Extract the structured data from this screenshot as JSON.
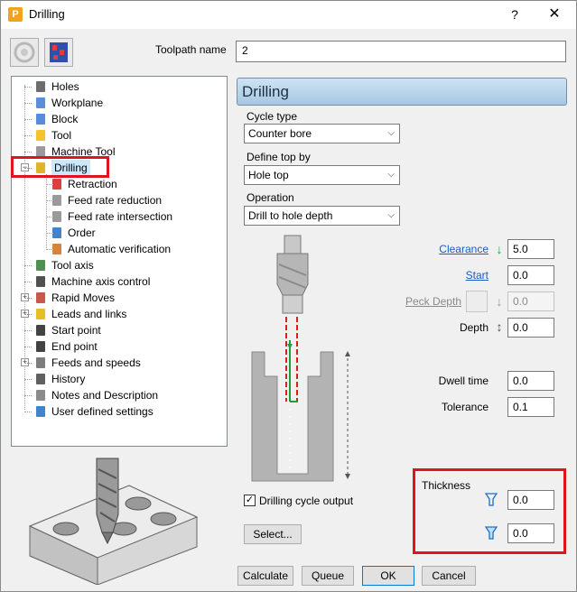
{
  "window": {
    "title": "Drilling",
    "help": "?",
    "close": "✕",
    "app_letter": "P"
  },
  "toolpath": {
    "label": "Toolpath name",
    "value": "2"
  },
  "tree": [
    {
      "label": "Holes",
      "icon": "holes-icon"
    },
    {
      "label": "Workplane",
      "icon": "workplane-icon"
    },
    {
      "label": "Block",
      "icon": "block-icon"
    },
    {
      "label": "Tool",
      "icon": "tool-icon"
    },
    {
      "label": "Machine Tool",
      "icon": "machine-tool-icon"
    },
    {
      "label": "Drilling",
      "icon": "drilling-icon",
      "selected": true,
      "expanded": true
    },
    {
      "label": "Retraction",
      "icon": "retraction-icon"
    },
    {
      "label": "Feed rate reduction",
      "icon": "feed-rate-reduction-icon"
    },
    {
      "label": "Feed rate intersection",
      "icon": "feed-rate-intersection-icon"
    },
    {
      "label": "Order",
      "icon": "order-icon"
    },
    {
      "label": "Automatic verification",
      "icon": "automatic-verification-icon"
    },
    {
      "label": "Tool axis",
      "icon": "tool-axis-icon"
    },
    {
      "label": "Machine axis control",
      "icon": "machine-axis-control-icon"
    },
    {
      "label": "Rapid Moves",
      "icon": "rapid-moves-icon"
    },
    {
      "label": "Leads and links",
      "icon": "leads-and-links-icon"
    },
    {
      "label": "Start point",
      "icon": "start-point-icon"
    },
    {
      "label": "End point",
      "icon": "end-point-icon"
    },
    {
      "label": "Feeds and speeds",
      "icon": "feeds-and-speeds-icon"
    },
    {
      "label": "History",
      "icon": "history-icon"
    },
    {
      "label": "Notes and Description",
      "icon": "notes-icon"
    },
    {
      "label": "User defined settings",
      "icon": "user-settings-icon"
    }
  ],
  "panel": {
    "title": "Drilling",
    "cycle_type": {
      "label": "Cycle type",
      "value": "Counter bore"
    },
    "define_top": {
      "label": "Define top by",
      "value": "Hole top"
    },
    "operation": {
      "label": "Operation",
      "value": "Drill to hole depth"
    },
    "clearance": {
      "label": "Clearance",
      "value": "5.0"
    },
    "start": {
      "label": "Start",
      "value": "0.0"
    },
    "peck_depth": {
      "label": "Peck Depth",
      "value": "0.0"
    },
    "depth": {
      "label": "Depth",
      "value": "0.0"
    },
    "dwell_time": {
      "label": "Dwell time",
      "value": "0.0"
    },
    "tolerance": {
      "label": "Tolerance",
      "value": "0.1"
    },
    "thickness": {
      "label": "Thickness",
      "value1": "0.0",
      "value2": "0.0"
    },
    "drilling_cycle_output": {
      "label": "Drilling cycle output",
      "checked": true
    },
    "select_button": "Select..."
  },
  "buttons": {
    "calculate": "Calculate",
    "queue": "Queue",
    "ok": "OK",
    "cancel": "Cancel"
  },
  "colors": {
    "highlight": "#e0141e",
    "link": "#1a5bc4",
    "clearance_arrow": "#1e9e3a"
  }
}
